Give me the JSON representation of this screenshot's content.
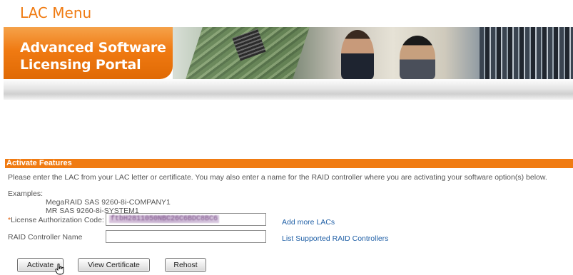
{
  "page": {
    "title": "LAC Menu"
  },
  "banner": {
    "line1": "Advanced Software",
    "line2": "Licensing Portal"
  },
  "activate_panel": {
    "heading": "Activate Features",
    "intro": "Please enter the LAC from your LAC letter or certificate. You may also enter a name for the RAID controller where you are activating your software option(s) below.",
    "examples_label": "Examples:",
    "examples": [
      "MegaRAID SAS 9260-8i-COMPANY1",
      "MR SAS 9260-8i-SYSTEM1"
    ],
    "lac_field": {
      "required_mark": "*",
      "label": "License Authorization Code:",
      "value": "ftbH2811050NBC26C6BDC8BC6"
    },
    "raid_field": {
      "label": "RAID Controller Name",
      "value": ""
    },
    "links": {
      "add_more": "Add more LACs",
      "list_supported": "List Supported RAID Controllers"
    },
    "buttons": {
      "activate": "Activate",
      "view_certificate": "View Certificate",
      "rehost": "Rehost"
    }
  },
  "colors": {
    "accent": "#f07b12",
    "link": "#1f5fa6",
    "text": "#555555"
  }
}
